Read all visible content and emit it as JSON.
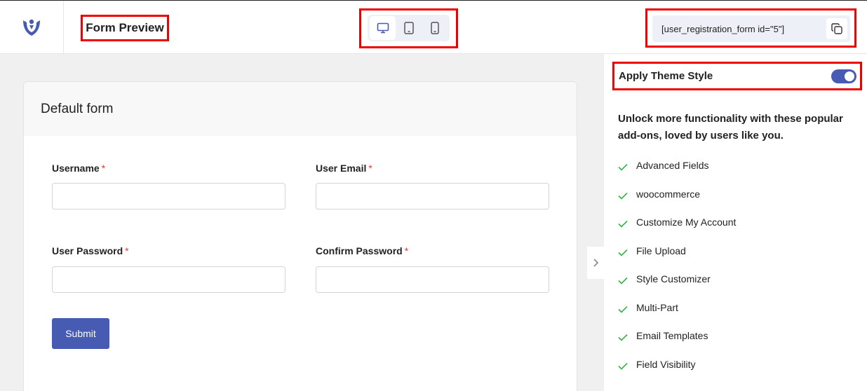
{
  "header": {
    "title": "Form Preview",
    "devices": [
      {
        "name": "desktop",
        "active": true
      },
      {
        "name": "tablet",
        "active": false
      },
      {
        "name": "mobile",
        "active": false
      }
    ],
    "shortcode": "[user_registration_form id=\"5\"]"
  },
  "form": {
    "title": "Default form",
    "fields": [
      {
        "label": "Username",
        "required": "*"
      },
      {
        "label": "User Email",
        "required": "*"
      },
      {
        "label": "User Password",
        "required": "*"
      },
      {
        "label": "Confirm Password",
        "required": "*"
      }
    ],
    "submit_label": "Submit"
  },
  "sidebar": {
    "theme_label": "Apply Theme Style",
    "theme_enabled": true,
    "promo_text": "Unlock more functionality with these popular add-ons, loved by users like you.",
    "addons": [
      "Advanced Fields",
      "woocommerce",
      "Customize My Account",
      "File Upload",
      "Style Customizer",
      "Multi-Part",
      "Email Templates",
      "Field Visibility"
    ]
  },
  "colors": {
    "accent": "#475bb2",
    "check": "#2fb344",
    "highlight": "#ee0000"
  }
}
